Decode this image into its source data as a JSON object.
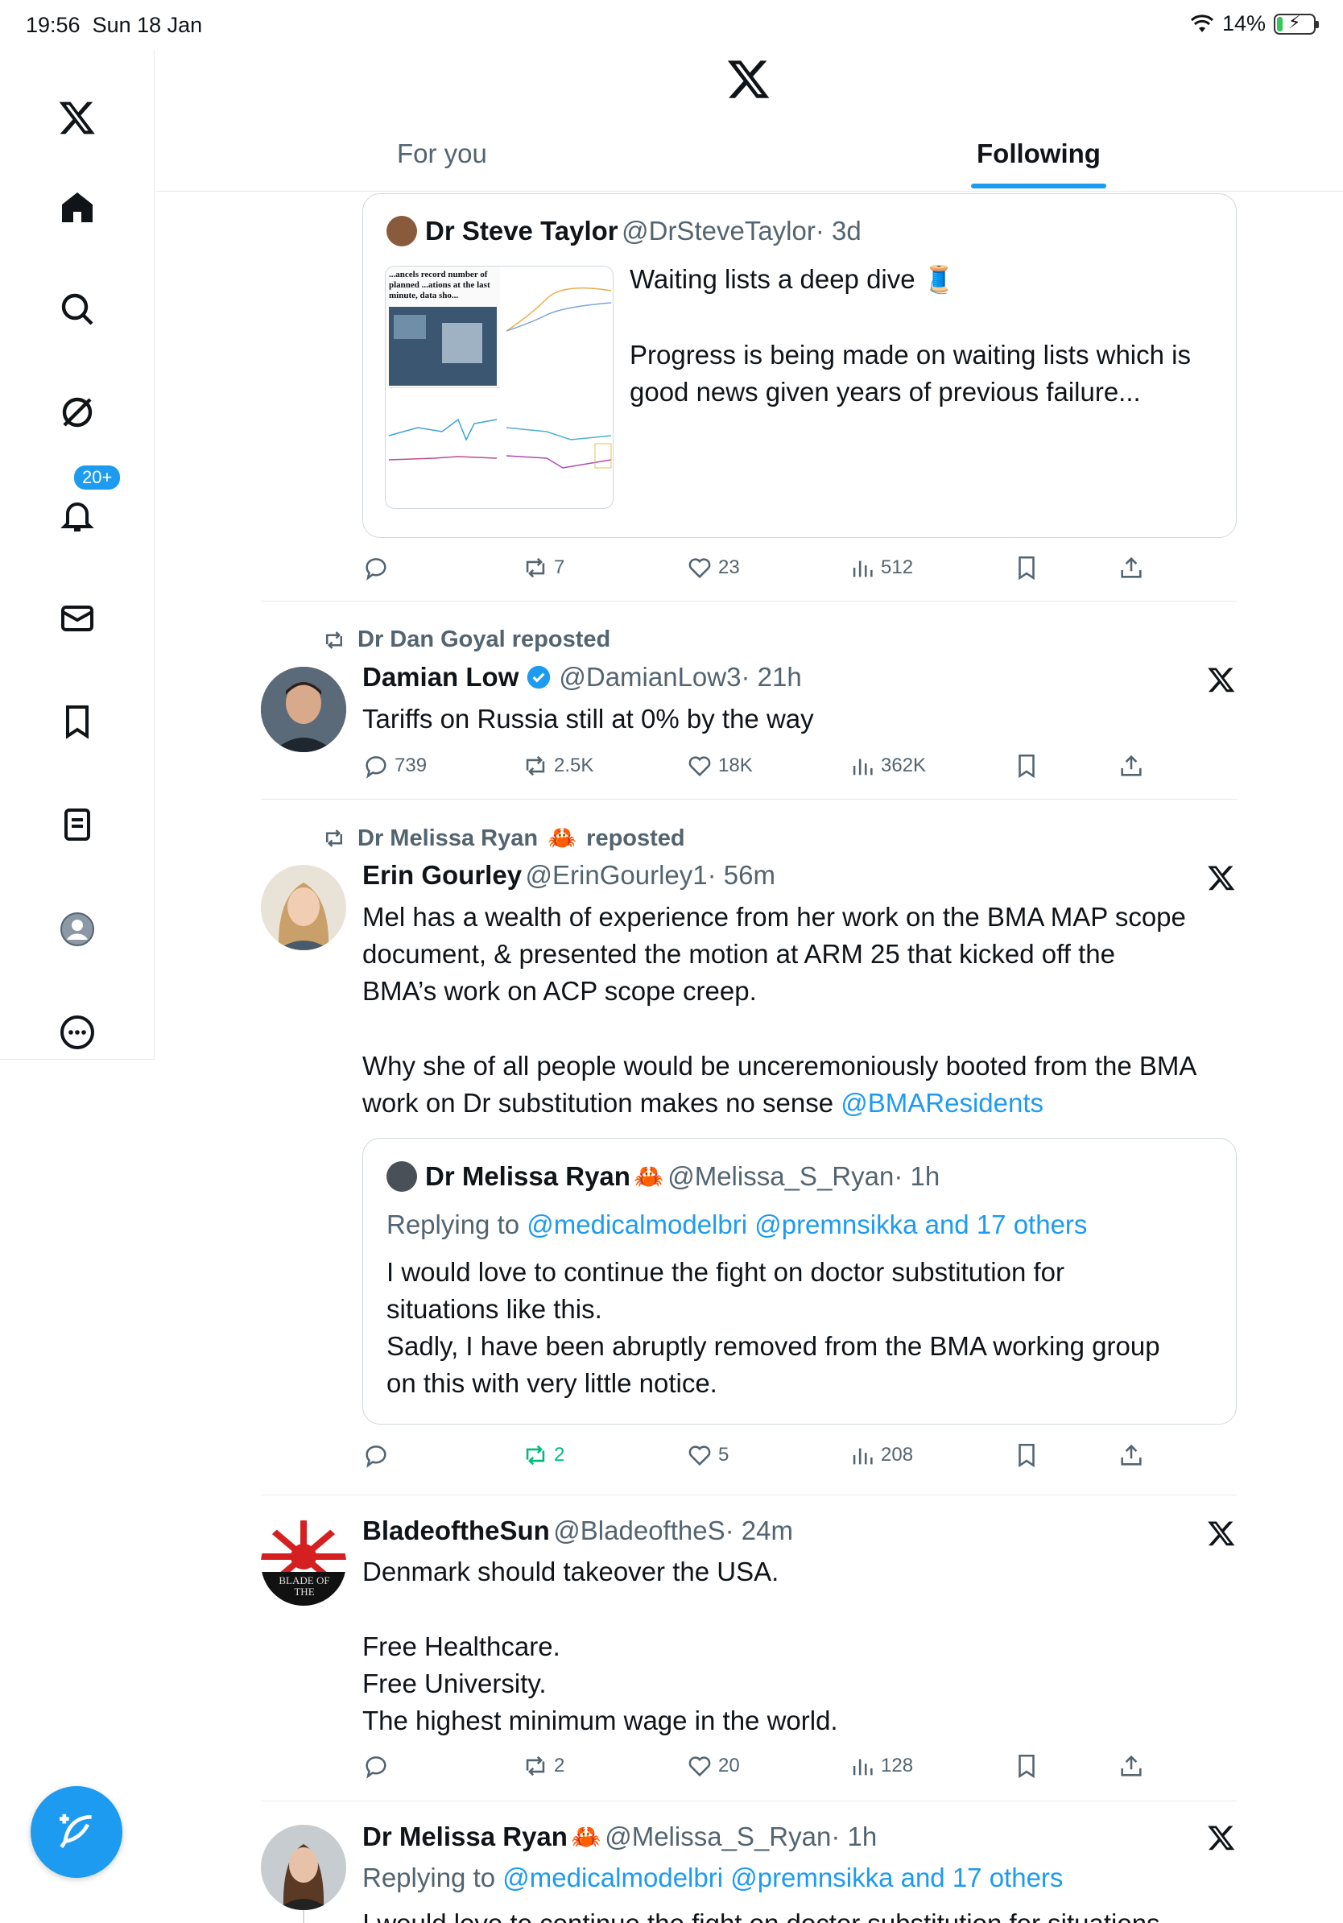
{
  "status": {
    "time": "19:56",
    "date": "Sun 18 Jan",
    "battery": "14%"
  },
  "sidebar": {
    "items": [
      "x-logo",
      "home",
      "search",
      "grok",
      "notifications",
      "messages",
      "bookmarks",
      "lists",
      "profile",
      "more"
    ],
    "notifications_badge": "20+"
  },
  "tabs": {
    "for_you": "For you",
    "following": "Following"
  },
  "quote1": {
    "name": "Dr Steve Taylor",
    "handle": "@DrSteveTaylor",
    "time": "· 3d",
    "line1": "Waiting lists a deep dive 🧵",
    "line2": "Progress is being made on waiting lists which is",
    "line3": "good news given years of previous failure...",
    "thumb_text": "...ancels record number of planned ...ations at the last minute, data sho..."
  },
  "post1_actions": {
    "replies": "",
    "reposts": "7",
    "likes": "23",
    "views": "512"
  },
  "post2": {
    "repost_by": "Dr Dan Goyal reposted",
    "name": "Damian Low",
    "handle": "@DamianLow3",
    "time": "· 21h",
    "text": "Tariffs on Russia still at 0% by the way",
    "replies": "739",
    "reposts": "2.5K",
    "likes": "18K",
    "views": "362K"
  },
  "post3": {
    "repost_by_name": "Dr Melissa Ryan",
    "repost_suffix": "reposted",
    "name": "Erin Gourley",
    "handle": "@ErinGourley1",
    "time": "· 56m",
    "line1": "Mel has a wealth of experience from her work on the BMA MAP scope",
    "line2": "document, & presented the motion at ARM 25 that kicked off the",
    "line3": "BMA’s work on ACP scope creep.",
    "line4": "Why she of all people would be unceremoniously booted from the BMA",
    "line5": "work on Dr substitution makes no sense",
    "mention": "@BMAResidents",
    "quote": {
      "name": "Dr Melissa Ryan",
      "handle": "@Melissa_S_Ryan",
      "time": "· 1h",
      "replying_prefix": "Replying to",
      "replying_to": "@medicalmodelbri @premnsikka and 17 others",
      "line1": "I would love to continue the fight on doctor substitution for",
      "line2": "situations like this.",
      "line3": "Sadly, I have been abruptly removed from the BMA working group",
      "line4": "on this with very little notice."
    },
    "replies": "",
    "reposts": "2",
    "likes": "5",
    "views": "208"
  },
  "post4": {
    "name": "BladeoftheSun",
    "handle": "@BladeoftheS",
    "time": "· 24m",
    "line1": "Denmark should takeover the USA.",
    "line2": "Free Healthcare.",
    "line3": "Free University.",
    "line4": "The highest minimum wage in the world.",
    "avatar_text": "BLADE OF THE",
    "replies": "",
    "reposts": "2",
    "likes": "20",
    "views": "128"
  },
  "post5": {
    "name": "Dr Melissa Ryan",
    "handle": "@Melissa_S_Ryan",
    "time": "· 1h",
    "replying_prefix": "Replying to",
    "replying_to": "@medicalmodelbri @premnsikka and 17 others",
    "partial": "I would love to continue the fight on doctor substitution for situations"
  }
}
